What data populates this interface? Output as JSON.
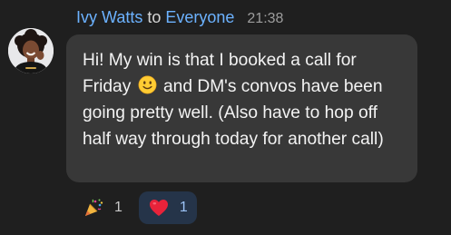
{
  "message": {
    "sender": "Ivy Watts",
    "to_word": "to",
    "recipient": "Everyone",
    "time": "21:38",
    "text_before_emoji": "Hi! My win is that I booked a call for Friday",
    "inline_emoji": "slightly-smiling-face-icon",
    "text_after_emoji": "and DM's convos have been going pretty well. (Also have to hop off half way through today for another call)"
  },
  "reactions": [
    {
      "emoji": "party-popper-icon",
      "count": "1",
      "selected": false
    },
    {
      "emoji": "red-heart-icon",
      "count": "1",
      "selected": true
    }
  ],
  "colors": {
    "background": "#1f1f1f",
    "bubble": "#383838",
    "name_accent": "#6cb2ff",
    "selected_reaction_bg": "#253449"
  }
}
